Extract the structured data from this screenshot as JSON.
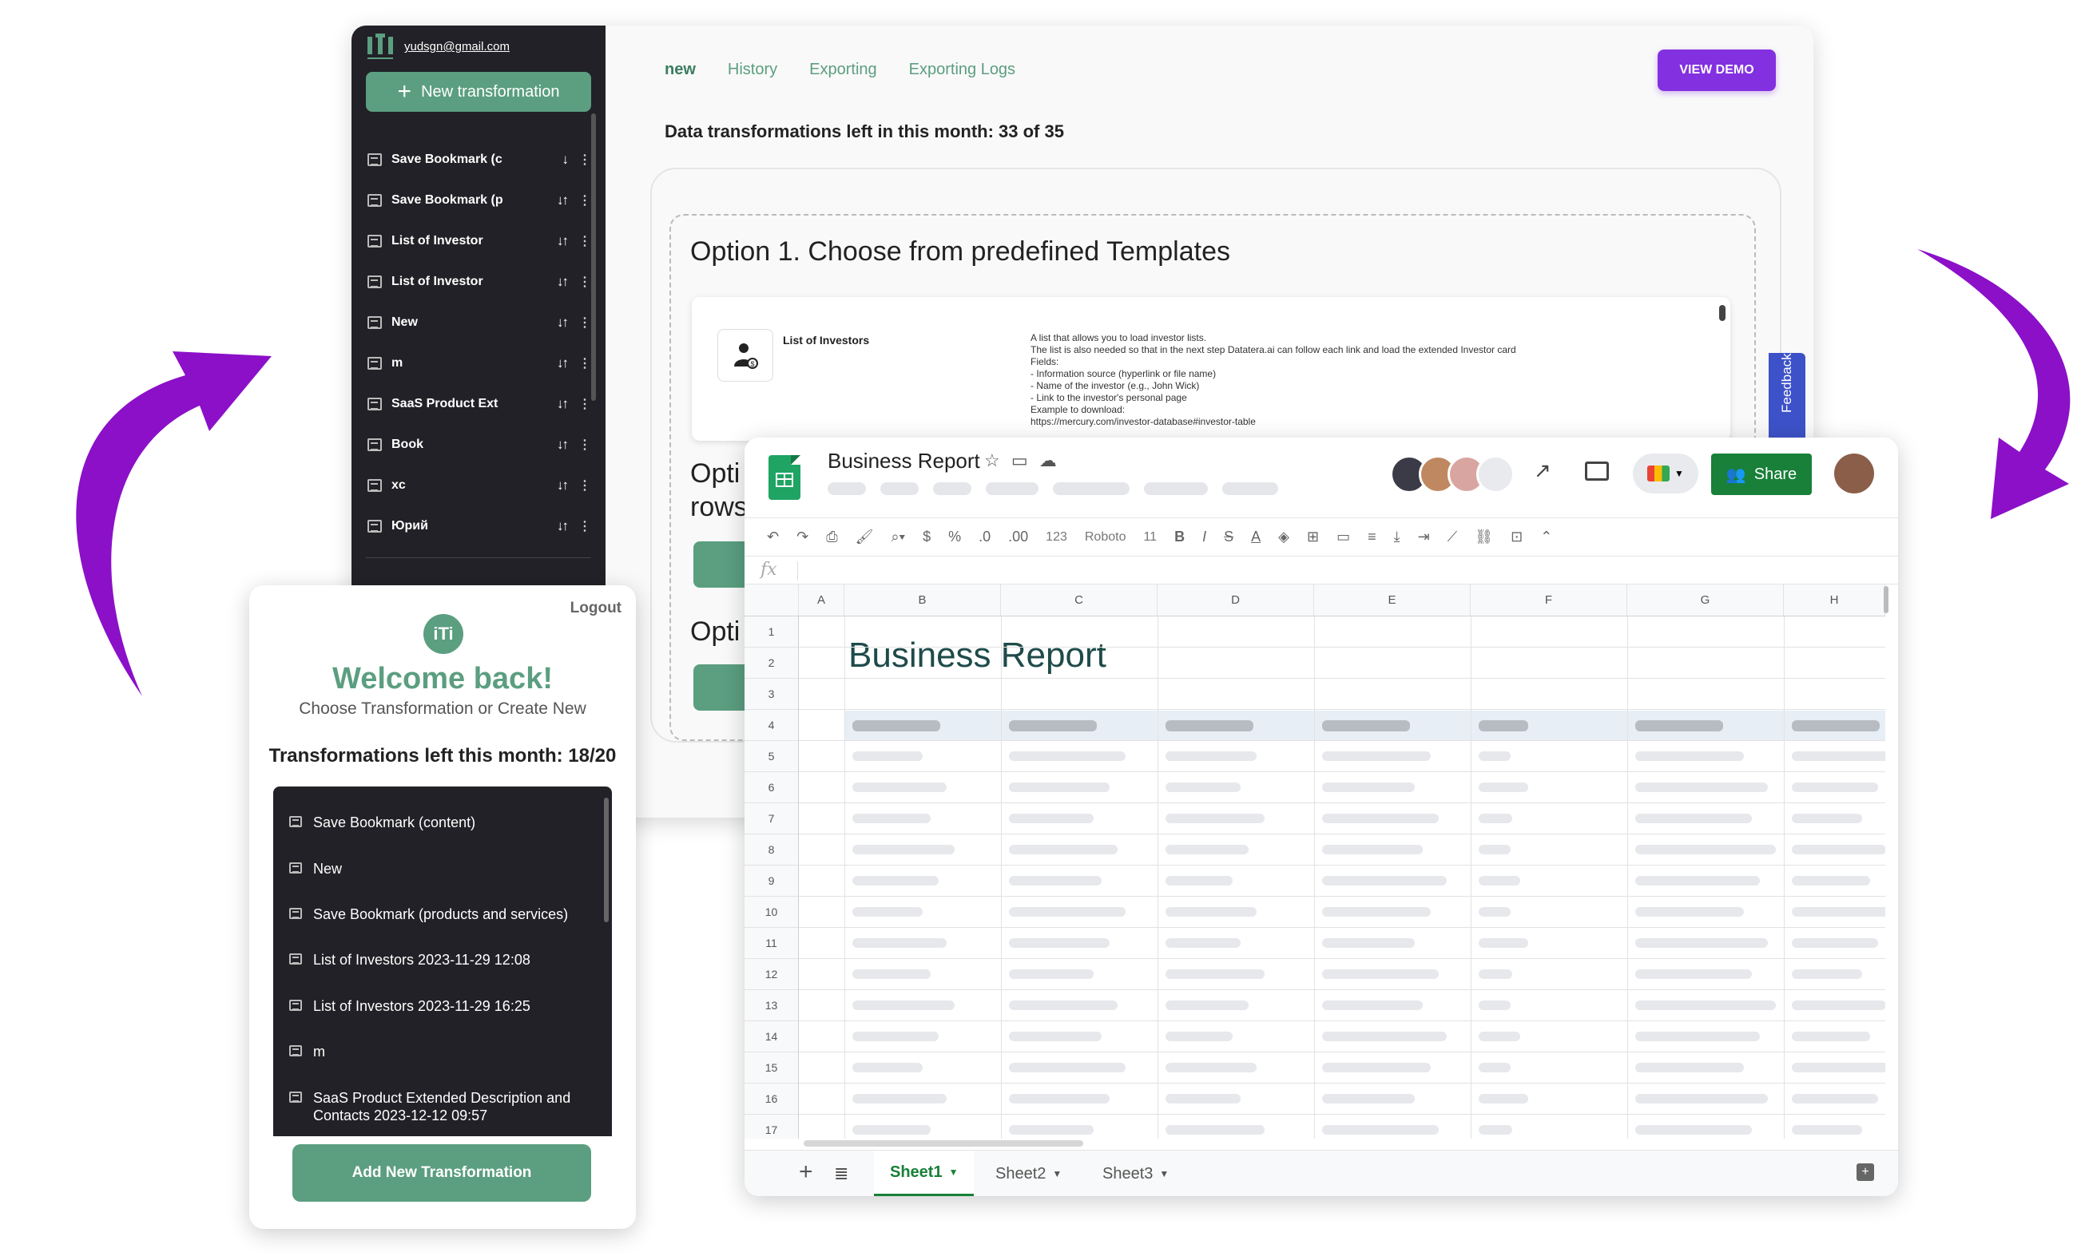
{
  "colors": {
    "accent_green": "#5b9e80",
    "demo_purple": "#8330e0",
    "sidebar_dark": "#212127",
    "arrow_purple": "#8b10c8",
    "sheets_green": "#188038",
    "feedback_blue": "#3d52c8"
  },
  "app": {
    "sidebar": {
      "email": "yudsgn@gmail.com",
      "new_button": "New transformation",
      "items": [
        {
          "label": "Save Bookmark (c",
          "arrows": "↓"
        },
        {
          "label": "Save Bookmark (p",
          "arrows": "↓↑"
        },
        {
          "label": "List of Investor",
          "arrows": "↓↑"
        },
        {
          "label": "List of Investor",
          "arrows": "↓↑"
        },
        {
          "label": "New",
          "arrows": "↓↑"
        },
        {
          "label": "m",
          "arrows": "↓↑"
        },
        {
          "label": "SaaS Product Ext",
          "arrows": "↓↑"
        },
        {
          "label": "Book",
          "arrows": "↓↑"
        },
        {
          "label": "xc",
          "arrows": "↓↑"
        },
        {
          "label": "Юрий",
          "arrows": "↓↑"
        }
      ]
    },
    "nav": {
      "tabs": [
        "new",
        "History",
        "Exporting",
        "Exporting Logs"
      ],
      "view_demo": "VIEW DEMO"
    },
    "quota": "Data transformations left in this month: 33 of 35",
    "option1_title": "Option 1. Choose from predefined Templates",
    "template_card": {
      "title": "List of Investors",
      "description": "A list that allows you to load investor lists.\nThe list is also needed so that in the next step Datatera.ai can follow each link and load the extended Investor card\nFields:\n- Information source (hyperlink or file name)\n- Name of the investor (e.g., John Wick)\n- Link to the investor's personal page\nExample to download:\nhttps://mercury.com/investor-database#investor-table"
    },
    "option2_partial": "Opti",
    "option2_partial_line2": "rows",
    "option3_partial": "Opti",
    "feedback": "Feedback"
  },
  "mobile": {
    "logout": "Logout",
    "logo_text": "iTi",
    "welcome": "Welcome back!",
    "subtitle": "Choose Transformation or Create New",
    "quota": "Transformations left this month: 18/20",
    "items": [
      "Save Bookmark (content)",
      "New",
      "Save Bookmark (products and services)",
      "List of Investors 2023-11-29 12:08",
      "List of Investors 2023-11-29 16:25",
      "m",
      "SaaS Product Extended Description and Contacts 2023-12-12 09:57"
    ],
    "add_button": "Add New Transformation"
  },
  "sheet": {
    "title": "Business Report",
    "title_icons": "☆ ▭ ☁",
    "share": "Share",
    "toolbar": {
      "font": "Roboto",
      "size": "11",
      "format_123": "123"
    },
    "fx": "fx",
    "columns": [
      "A",
      "B",
      "C",
      "D",
      "E",
      "F",
      "G",
      "H"
    ],
    "rows": [
      "1",
      "2",
      "3",
      "4",
      "5",
      "6",
      "7",
      "8",
      "9",
      "10",
      "11",
      "12",
      "13",
      "14",
      "15",
      "16",
      "17"
    ],
    "report_heading": "Business Report",
    "tabs": [
      "Sheet1",
      "Sheet2",
      "Sheet3"
    ]
  }
}
